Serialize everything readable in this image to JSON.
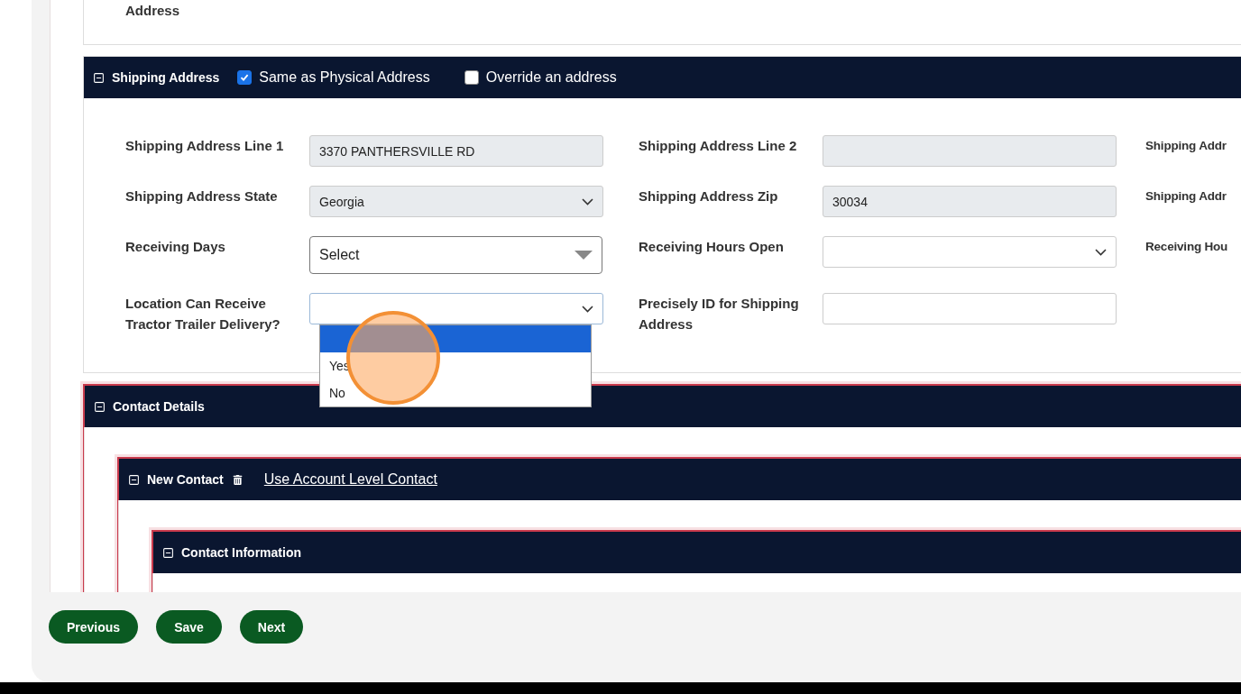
{
  "top_section": {
    "label": "Address"
  },
  "shipping_address": {
    "title": "Shipping Address",
    "expanded": true,
    "options": [
      {
        "label": "Same as Physical Address",
        "checked": true
      },
      {
        "label": "Override an address",
        "checked": false
      }
    ],
    "rows": [
      [
        {
          "kind": "text",
          "label": "Shipping Address Line 1",
          "value": "3370 PANTHERSVILLE RD",
          "disabled": true
        },
        {
          "kind": "text",
          "label": "Shipping Address Line 2",
          "disabled": true
        },
        {
          "kind": "label",
          "label": "Shipping Addr"
        }
      ],
      [
        {
          "kind": "select",
          "label": "Shipping Address State",
          "value": "Georgia",
          "disabled": true
        },
        {
          "kind": "text",
          "label": "Shipping Address Zip",
          "value": "30034",
          "disabled": true
        },
        {
          "kind": "label",
          "label": "Shipping Addr"
        }
      ],
      [
        {
          "kind": "legacy-select",
          "label": "Receiving Days",
          "value": "Select",
          "disabled": false
        },
        {
          "kind": "select",
          "label": "Receiving Hours Open",
          "disabled": false
        },
        {
          "kind": "label",
          "label": "Receiving Hou"
        }
      ],
      [
        {
          "kind": "select",
          "label": "Location Can Receive Tractor Trailer Delivery?",
          "disabled": false,
          "open": true,
          "options": [
            {
              "label": "Yes"
            },
            {
              "label": "No"
            }
          ]
        },
        {
          "kind": "text",
          "label": "Precisely ID for Shipping Address",
          "disabled": false
        }
      ]
    ]
  },
  "contact_details": {
    "title": "Contact Details",
    "expanded": true,
    "contact": {
      "title": "New Contact",
      "expanded": true,
      "link": "Use Account Level Contact",
      "information": {
        "title": "Contact Information",
        "expanded": true
      }
    }
  },
  "buttons": [
    "Previous",
    "Save",
    "Next"
  ]
}
